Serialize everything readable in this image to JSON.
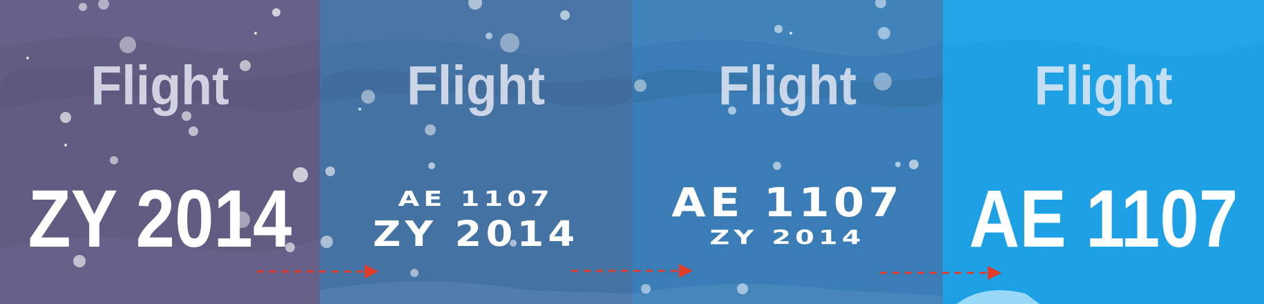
{
  "panels": [
    {
      "label": "Flight",
      "code": "ZY 2014",
      "background": "#625b82"
    },
    {
      "label": "Flight",
      "code_top": "AE 1107",
      "code_bottom": "ZY 2014",
      "background": "#4472a2"
    },
    {
      "label": "Flight",
      "code_top": "AE 1107",
      "code_bottom": "ZY 2014",
      "background": "#3a7cb5"
    },
    {
      "label": "Flight",
      "code": "AE 1107",
      "background": "#1ea1e4"
    }
  ],
  "arrow_color": "#e23b2a",
  "transition_arrows": [
    "arrow-right-dashed-icon",
    "arrow-right-dashed-icon",
    "arrow-right-dashed-icon"
  ]
}
